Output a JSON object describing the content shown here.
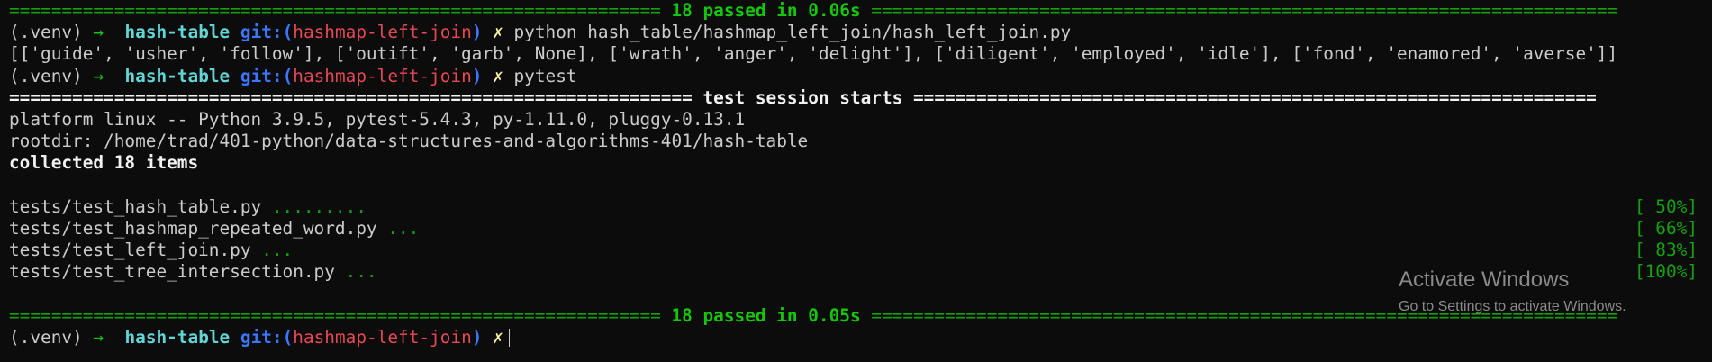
{
  "colors": {
    "background": "#0c0c0c",
    "foreground": "#cccccc",
    "green": "#13a10e",
    "bright_green": "#16c60c",
    "cyan": "#61d6d6",
    "blue": "#3b78ff",
    "red": "#e74856",
    "yellow": "#f9f1a5"
  },
  "top_summary": {
    "left_rule": "==============================================================",
    "text": " 18 passed in 0.06s ",
    "right_rule": "======================================================================="
  },
  "prompt": {
    "venv": "(.venv)",
    "arrow": "→",
    "dir": "hash-table",
    "git_open": "git:(",
    "branch": "hashmap-left-join",
    "git_close": ")",
    "dirty": "✗"
  },
  "commands": {
    "first": "python hash_table/hashmap_left_join/hash_left_join.py",
    "second": "pytest"
  },
  "output_line": "[['guide', 'usher', 'follow'], ['outift', 'garb', None], ['wrath', 'anger', 'delight'], ['diligent', 'employed', 'idle'], ['fond', 'enamored', 'averse']]",
  "session_header": {
    "left_rule": "=================================================================",
    "text": " test session starts ",
    "right_rule": "================================================================="
  },
  "platform_line": "platform linux -- Python 3.9.5, pytest-5.4.3, py-1.11.0, pluggy-0.13.1",
  "rootdir_line": "rootdir: /home/trad/401-python/data-structures-and-algorithms-401/hash-table",
  "collected_line": "collected 18 items",
  "tests": [
    {
      "file": "tests/test_hash_table.py",
      "dots": " .........",
      "percent": "[ 50%]"
    },
    {
      "file": "tests/test_hashmap_repeated_word.py",
      "dots": " ...",
      "percent": "[ 66%]"
    },
    {
      "file": "tests/test_left_join.py",
      "dots": " ...",
      "percent": "[ 83%]"
    },
    {
      "file": "tests/test_tree_intersection.py",
      "dots": " ...",
      "percent": "[100%]"
    }
  ],
  "bottom_summary": {
    "left_rule": "==============================================================",
    "text": " 18 passed in 0.05s ",
    "right_rule": "======================================================================="
  },
  "watermark": {
    "title": "Activate Windows",
    "subtitle": "Go to Settings to activate Windows."
  }
}
